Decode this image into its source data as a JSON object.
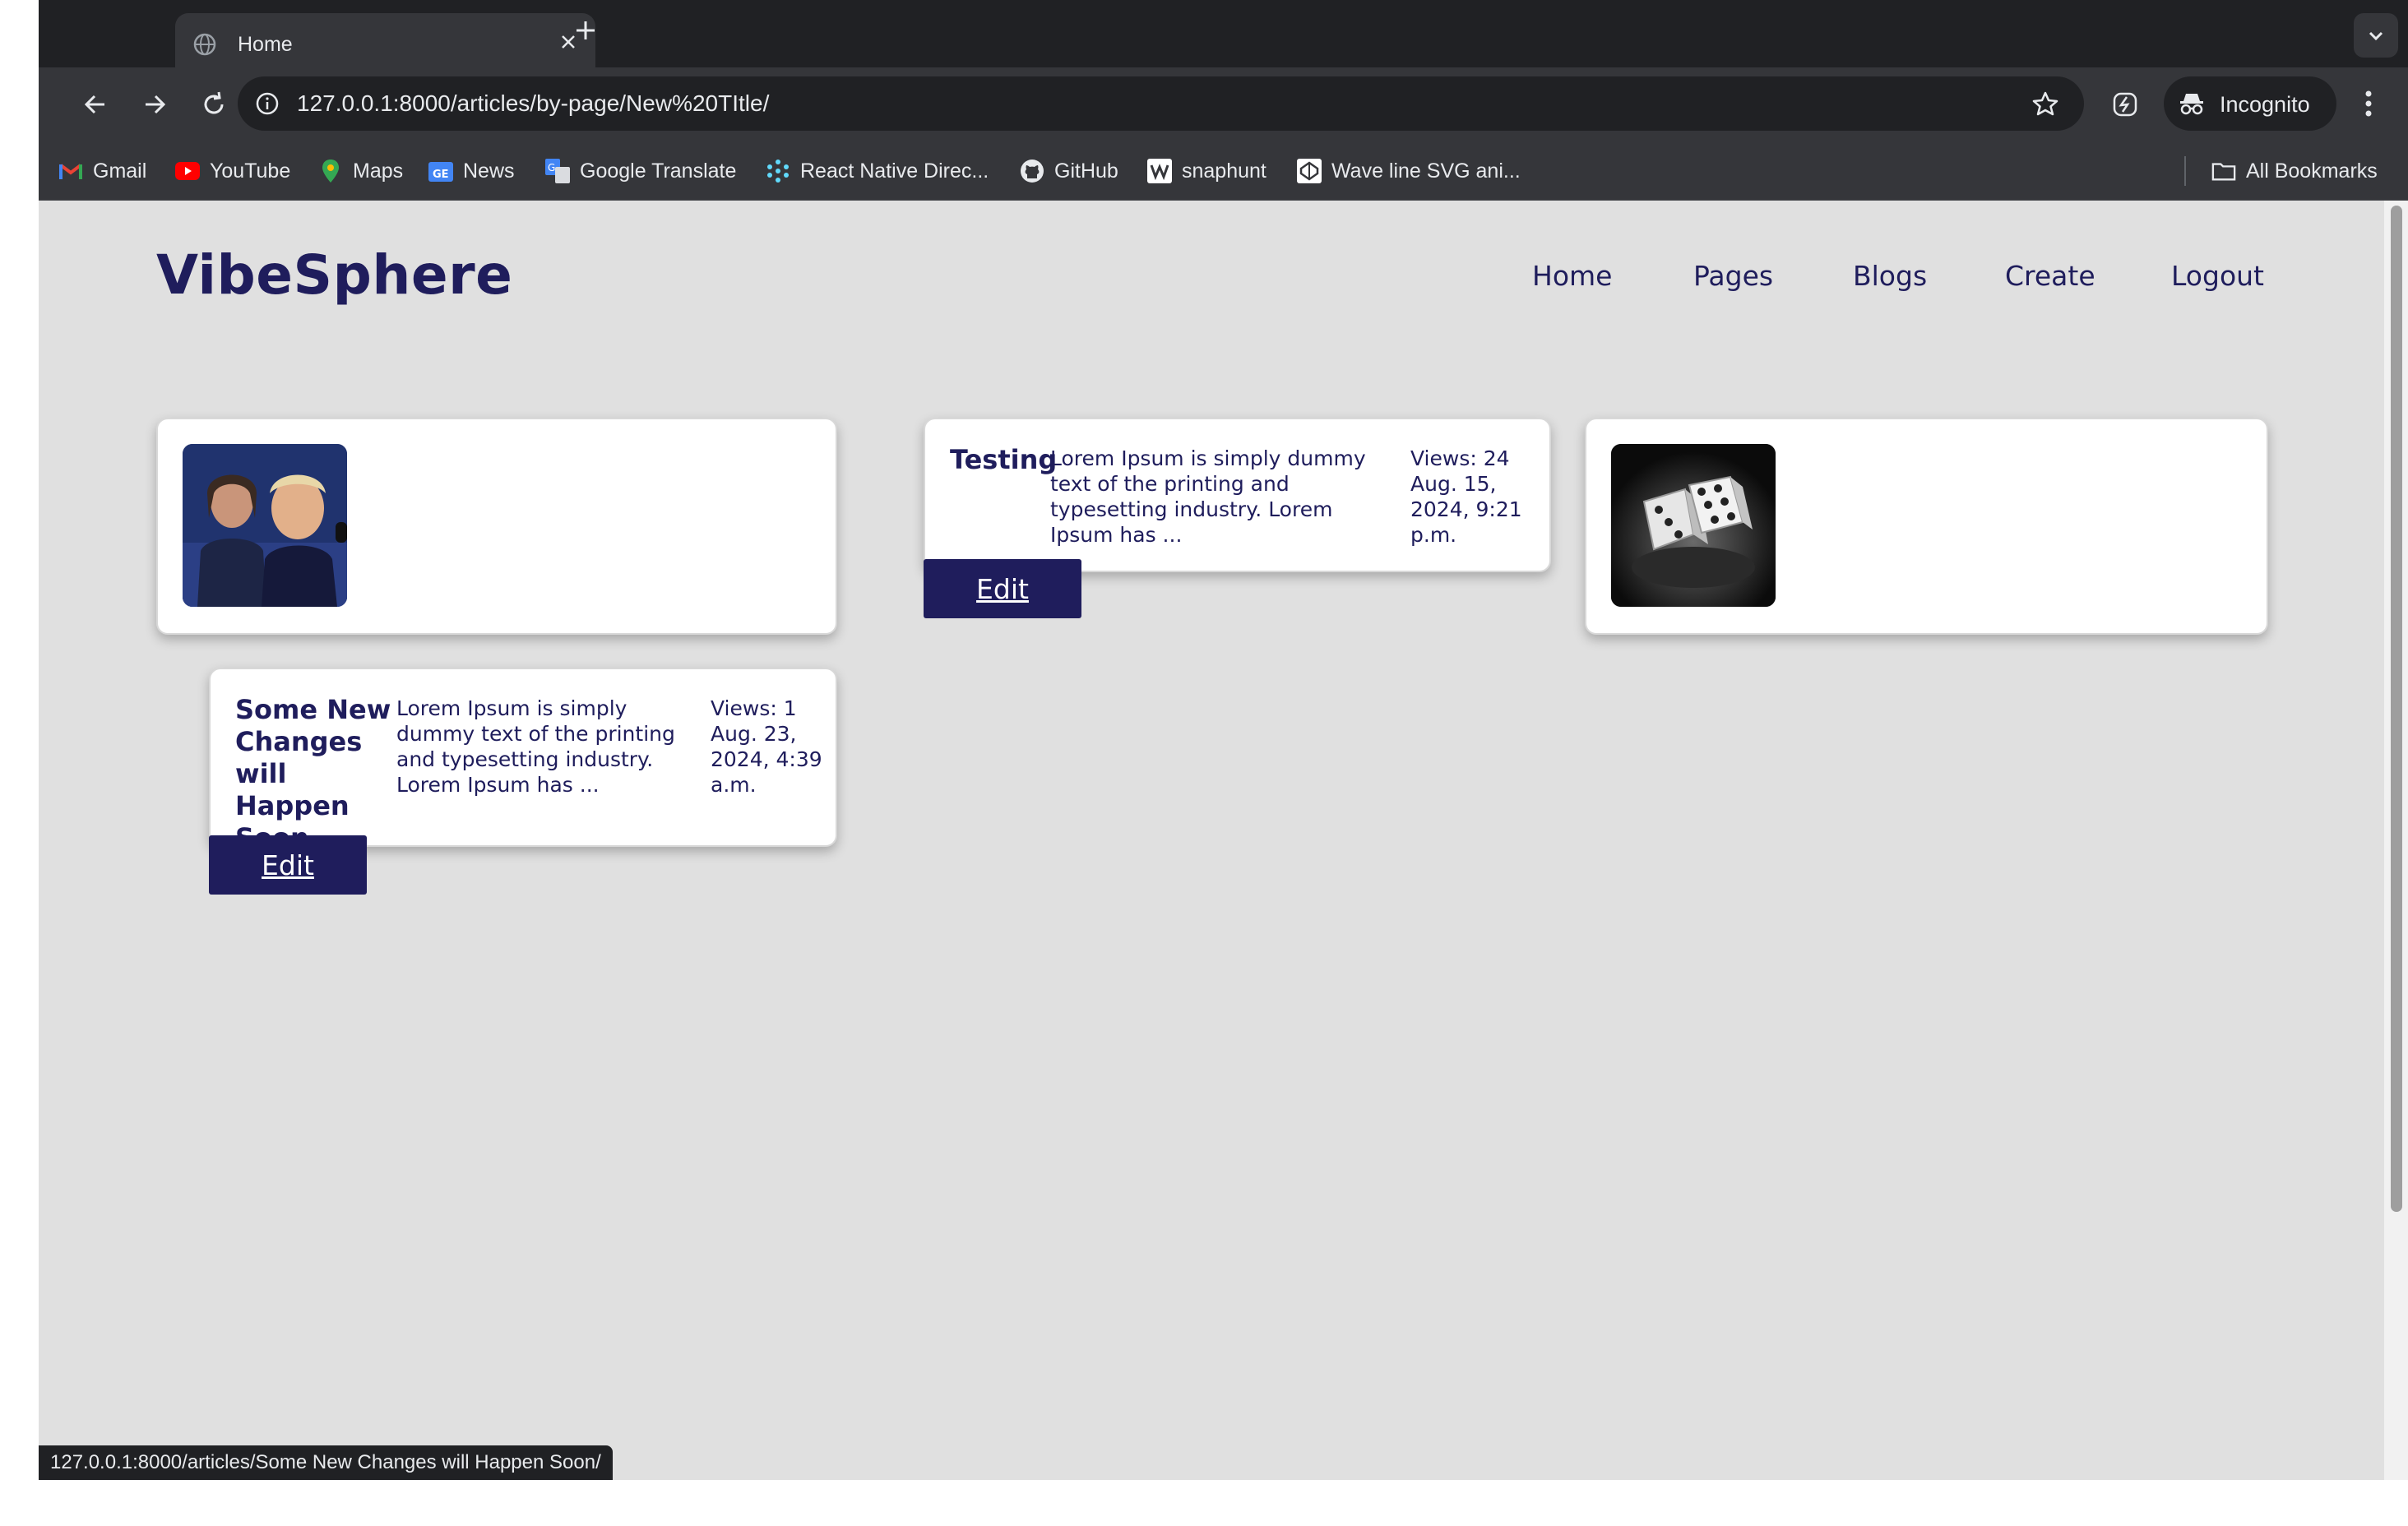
{
  "browser": {
    "tab_title": "Home",
    "url": "127.0.0.1:8000/articles/by-page/New%20TItle/",
    "incognito_label": "Incognito",
    "bookmarks": [
      {
        "label": "Gmail",
        "icon": "gmail-icon"
      },
      {
        "label": "YouTube",
        "icon": "youtube-icon"
      },
      {
        "label": "Maps",
        "icon": "maps-icon"
      },
      {
        "label": "News",
        "icon": "news-icon"
      },
      {
        "label": "Google Translate",
        "icon": "translate-icon"
      },
      {
        "label": "React Native Direc...",
        "icon": "react-icon"
      },
      {
        "label": "GitHub",
        "icon": "github-icon"
      },
      {
        "label": "snaphunt",
        "icon": "snaphunt-icon"
      },
      {
        "label": "Wave line SVG ani...",
        "icon": "codepen-icon"
      }
    ],
    "all_bookmarks_label": "All Bookmarks",
    "status_url": "127.0.0.1:8000/articles/Some New Changes will Happen Soon/"
  },
  "site": {
    "brand": "VibeSphere",
    "nav": [
      "Home",
      "Pages",
      "Blogs",
      "Create",
      "Logout"
    ],
    "primary_color": "#1f1d5c",
    "background_color": "#e0e0e0"
  },
  "articles": [
    {
      "title": "Testing",
      "excerpt": "Lorem Ipsum is simply dummy text of the printing and typesetting industry. Lorem Ipsum has ...",
      "views": "Views: 24",
      "date": "Aug. 15, 2024, 9:21 p.m.",
      "edit_label": "Edit"
    },
    {
      "title": "Some New Changes will Happen Soon",
      "excerpt": "Lorem Ipsum is simply dummy text of the printing and typesetting industry. Lorem Ipsum has ...",
      "views": "Views: 1",
      "date": "Aug. 23, 2024, 4:39 a.m.",
      "edit_label": "Edit"
    }
  ],
  "image_cards": [
    {
      "image": "politicians-photo"
    },
    {
      "image": "dice-photo"
    }
  ]
}
